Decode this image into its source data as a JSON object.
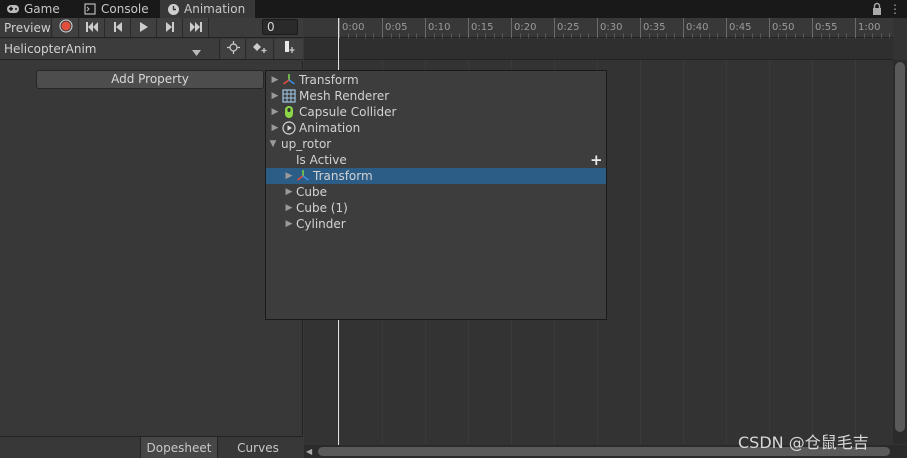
{
  "tabs": [
    {
      "label": "Game",
      "icon": "gamepad-icon"
    },
    {
      "label": "Console",
      "icon": "console-icon"
    },
    {
      "label": "Animation",
      "icon": "clock-icon"
    }
  ],
  "toolbar": {
    "preview_label": "Preview",
    "frame_value": "0"
  },
  "clip": {
    "name": "HelicopterAnim"
  },
  "left_panel": {
    "add_property_label": "Add Property"
  },
  "timeline": {
    "ticks": [
      "0:00",
      "0:05",
      "0:10",
      "0:15",
      "0:20",
      "0:25",
      "0:30",
      "0:35",
      "0:40",
      "0:45",
      "0:50",
      "0:55",
      "1:00"
    ]
  },
  "bottom_tabs": {
    "dopesheet": "Dopesheet",
    "curves": "Curves"
  },
  "popup": {
    "rows": [
      {
        "label": "Transform",
        "icon": "transform-icon",
        "arrow": "▶"
      },
      {
        "label": "Mesh Renderer",
        "icon": "mesh-renderer-icon",
        "arrow": "▶"
      },
      {
        "label": "Capsule Collider",
        "icon": "capsule-collider-icon",
        "arrow": "▶"
      },
      {
        "label": "Animation",
        "icon": "animation-icon",
        "arrow": "▶"
      },
      {
        "label": "up_rotor",
        "icon": "",
        "arrow": "▼"
      },
      {
        "label": "Is Active",
        "icon": "",
        "arrow": ""
      },
      {
        "label": "Transform",
        "icon": "transform-icon",
        "arrow": "▶"
      },
      {
        "label": "Cube",
        "icon": "",
        "arrow": "▶"
      },
      {
        "label": "Cube (1)",
        "icon": "",
        "arrow": "▶"
      },
      {
        "label": "Cylinder",
        "icon": "",
        "arrow": "▶"
      }
    ]
  },
  "watermark": "CSDN @仓鼠毛吉",
  "colors": {
    "selection": "#2c5d87",
    "record": "#e0503c"
  }
}
